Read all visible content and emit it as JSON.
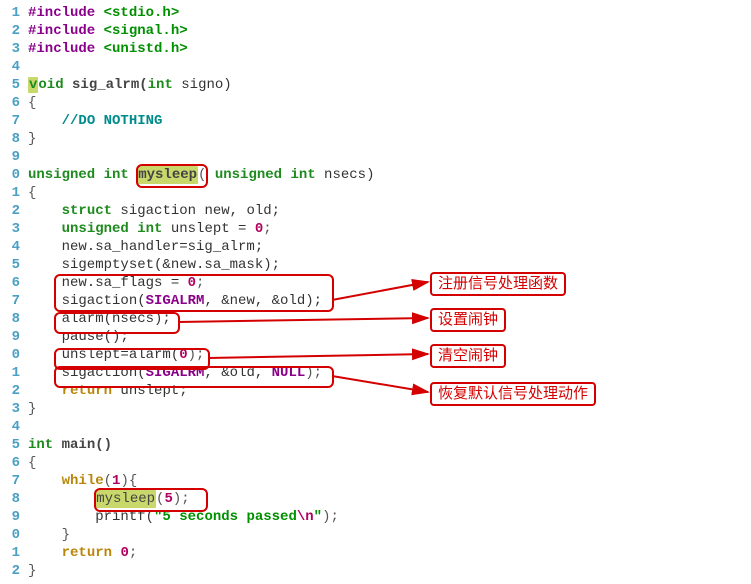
{
  "gutter": [
    "1",
    "2",
    "3",
    "4",
    "5",
    "6",
    "7",
    "8",
    "9",
    "0",
    "1",
    "2",
    "3",
    "4",
    "5",
    "6",
    "7",
    "8",
    "9",
    "0",
    "1",
    "2",
    "3",
    "4",
    "5",
    "6",
    "7",
    "8",
    "9",
    "0",
    "1",
    "2"
  ],
  "code": {
    "l1_macro": "#include",
    "l1_inc": " <stdio.h>",
    "l2_macro": "#include",
    "l2_inc": " <signal.h>",
    "l3_macro": "#include",
    "l3_inc": " <unistd.h>",
    "l5_v": "v",
    "l5_oid": "oid",
    "l5_fn": " sig_alrm(",
    "l5_int": "int",
    "l5_rest": " signo)",
    "l6": "{",
    "l7_indent": "    ",
    "l7_comment": "//DO NOTHING",
    "l8": "}",
    "l10_uint": "unsigned int ",
    "l10_fn": "mysleep",
    "l10_open": "(",
    "l10_uint2": " unsigned int",
    "l10_rest": " nsecs)",
    "l11": "{",
    "l12_indent": "    ",
    "l12_struct": "struct",
    "l12_rest": " sigaction new, old;",
    "l13_indent": "    ",
    "l13_uint": "unsigned int",
    "l13_rest": " unslept = ",
    "l13_zero": "0",
    "l13_semi": ";",
    "l14": "    new.sa_handler=sig_alrm;",
    "l15": "    sigemptyset(&new.sa_mask);",
    "l16_a": "    new.sa_flags = ",
    "l16_b": "0",
    "l16_c": ";",
    "l17_a": "    sigaction(",
    "l17_b": "SIGALRM",
    "l17_c": ", &new, &old);",
    "l18_a": "    alarm(nsecs);",
    "l19": "    pause();",
    "l20_a": "    unslept=alarm(",
    "l20_b": "0",
    "l20_c": ");",
    "l21_a": "    sigaction(",
    "l21_b": "SIGALRM",
    "l21_c": ", &old, ",
    "l21_d": "NULL",
    "l21_e": ");",
    "l22_a": "    ",
    "l22_ret": "return",
    "l22_b": " unslept;",
    "l23": "}",
    "l25_int": "int",
    "l25_rest": " main()",
    "l26": "{",
    "l27_a": "    ",
    "l27_while": "while",
    "l27_b": "(",
    "l27_c": "1",
    "l27_d": "){",
    "l28_a": "        ",
    "l28_fn": "mysleep",
    "l28_b": "(",
    "l28_c": "5",
    "l28_d": ");",
    "l29_a": "        printf(",
    "l29_str1": "\"5 seconds passed",
    "l29_esc": "\\n",
    "l29_str2": "\"",
    "l29_b": ");",
    "l30": "    }",
    "l31_a": "    ",
    "l31_ret": "return",
    "l31_b": " ",
    "l31_c": "0",
    "l31_d": ";",
    "l32": "}"
  },
  "callouts": {
    "c1": "注册信号处理函数",
    "c2": "设置闹钟",
    "c3": "清空闹钟",
    "c4": "恢复默认信号处理动作"
  }
}
